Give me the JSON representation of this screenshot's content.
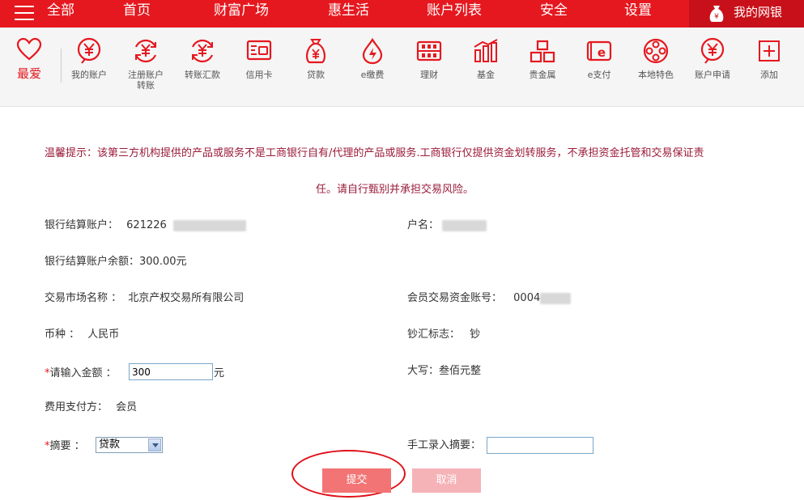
{
  "topnav": {
    "items": [
      "全部",
      "首页",
      "财富广场",
      "惠生活",
      "账户列表",
      "安全",
      "设置"
    ],
    "mybank_label": "我的网银",
    "bg_color": "#e5181f"
  },
  "favorites": {
    "label": "最爱",
    "icon": "heart-icon"
  },
  "quick_items": [
    {
      "label": "我的账户",
      "icon": "yuan-circle-icon"
    },
    {
      "label": "注册账户\n转账",
      "icon": "yuan-transfer-icon"
    },
    {
      "label": "转账汇款",
      "icon": "yuan-transfer-icon"
    },
    {
      "label": "信用卡",
      "icon": "credit-card-icon"
    },
    {
      "label": "贷款",
      "icon": "money-bag-icon"
    },
    {
      "label": "e缴费",
      "icon": "drop-icon"
    },
    {
      "label": "理财",
      "icon": "abacus-icon"
    },
    {
      "label": "基金",
      "icon": "bar-chart-icon"
    },
    {
      "label": "贵金属",
      "icon": "gold-bars-icon"
    },
    {
      "label": "e支付",
      "icon": "epay-icon"
    },
    {
      "label": "本地特色",
      "icon": "film-reel-icon"
    },
    {
      "label": "账户申请",
      "icon": "yuan-circle-icon"
    },
    {
      "label": "添加",
      "icon": "plus-box-icon"
    }
  ],
  "notice": {
    "line1": "温馨提示：该第三方机构提供的产品或服务不是工商银行自有/代理的产品或服务.工商银行仅提供资金划转服务，不承担资金托管和交易保证责",
    "line2": "任。请自行甄别并承担交易风险。"
  },
  "form": {
    "settlement_account_label": "银行结算账户：",
    "settlement_account_value": "621226",
    "account_name_label": "户名：",
    "balance_label": "银行结算账户余额：",
    "balance_value": "300.00元",
    "market_label": "交易市场名称 ：",
    "market_value": "北京产权交易所有限公司",
    "member_account_label": "会员交易资金账号：",
    "member_account_value": "0004",
    "currency_label": "币种 ：",
    "currency_value": "人民币",
    "cash_flag_label": "钞汇标志：",
    "cash_flag_value": "钞",
    "amount_label": "请输入金额 ：",
    "amount_value": "300",
    "amount_unit": "元",
    "uppercase_label": "大写：",
    "uppercase_value": "叁佰元整",
    "fee_payer_label": "费用支付方：",
    "fee_payer_value": "会员",
    "summary_label": "摘要 ：",
    "summary_selected": "贷款",
    "manual_summary_label": "手工录入摘要：",
    "manual_summary_value": "",
    "required_mark": "*"
  },
  "buttons": {
    "submit": "提交",
    "cancel": "取消"
  }
}
